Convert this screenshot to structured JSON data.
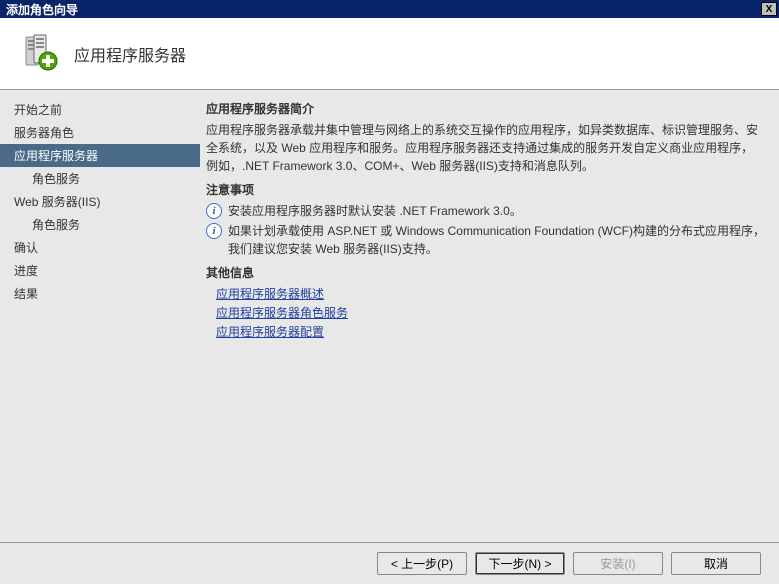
{
  "window": {
    "title": "添加角色向导",
    "close_x": "X"
  },
  "header": {
    "title": "应用程序服务器"
  },
  "sidebar": {
    "items": [
      {
        "label": "开始之前",
        "selected": false,
        "sub": false
      },
      {
        "label": "服务器角色",
        "selected": false,
        "sub": false
      },
      {
        "label": "应用程序服务器",
        "selected": true,
        "sub": false
      },
      {
        "label": "角色服务",
        "selected": false,
        "sub": true
      },
      {
        "label": "Web 服务器(IIS)",
        "selected": false,
        "sub": false
      },
      {
        "label": "角色服务",
        "selected": false,
        "sub": true
      },
      {
        "label": "确认",
        "selected": false,
        "sub": false
      },
      {
        "label": "进度",
        "selected": false,
        "sub": false
      },
      {
        "label": "结果",
        "selected": false,
        "sub": false
      }
    ]
  },
  "content": {
    "intro_title": "应用程序服务器简介",
    "intro_text": "应用程序服务器承载并集中管理与网络上的系统交互操作的应用程序，如异类数据库、标识管理服务、安全系统，以及 Web 应用程序和服务。应用程序服务器还支持通过集成的服务开发自定义商业应用程序，例如，.NET Framework 3.0、COM+、Web 服务器(IIS)支持和消息队列。",
    "notes_title": "注意事项",
    "note1": "安装应用程序服务器时默认安装 .NET Framework 3.0。",
    "note2": "如果计划承载使用 ASP.NET 或 Windows Communication Foundation (WCF)构建的分布式应用程序，我们建议您安装 Web 服务器(IIS)支持。",
    "other_title": "其他信息",
    "link1": "应用程序服务器概述",
    "link2": "应用程序服务器角色服务",
    "link3": "应用程序服务器配置"
  },
  "footer": {
    "prev": "< 上一步(P)",
    "next": "下一步(N) >",
    "install": "安装(I)",
    "cancel": "取消"
  }
}
